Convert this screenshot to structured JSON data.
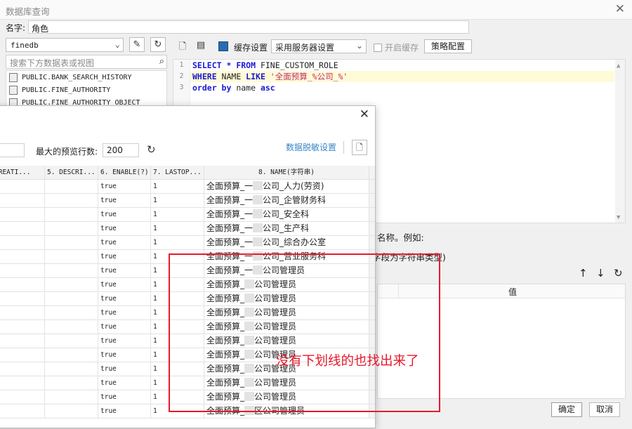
{
  "window": {
    "title": "数据库查询"
  },
  "name_field": {
    "label": "名字:",
    "value": "角色"
  },
  "db_panel": {
    "connection": "finedb",
    "search_placeholder": "搜索下方数据表或视图",
    "tables": [
      "PUBLIC.BANK_SEARCH_HISTORY",
      "PUBLIC.FINE_AUTHORITY",
      "PUBLIC.FINE_AUTHORITY_OBJECT"
    ]
  },
  "toolbar": {
    "cache_settings": "缓存设置",
    "server_setting": "采用服务器设置",
    "enable_cache": "开启缓存",
    "strategy": "策略配置"
  },
  "sql": {
    "line_numbers": [
      "1",
      "2",
      "3"
    ],
    "l1_kw1": "SELECT",
    "l1_star": " * ",
    "l1_kw2": "FROM",
    "l1_rest": " FINE_CUSTOM_ROLE",
    "l2_kw1": "WHERE",
    "l2_mid": " NAME ",
    "l2_kw2": "LIKE",
    "l2_str": " '全面预算_%公司_%'",
    "l3_kw1": "order by",
    "l3_mid": " name ",
    "l3_kw2": "asc"
  },
  "params": {
    "hint1": "名称。例如:",
    "hint2": "字段为字符串类型)",
    "value_header": "值"
  },
  "buttons": {
    "ok": "确定",
    "cancel": "取消"
  },
  "preview": {
    "max_rows_label": "最大的预览行数:",
    "max_rows": "200",
    "mask_settings": "数据脱敏设置",
    "columns": [
      "CREATI...",
      "5. DESCRI...",
      "6. ENABLE(?)",
      "7. LASTOP...",
      "8. NAME(字符串)"
    ],
    "rows": [
      {
        "enable": "true",
        "lastop": "1",
        "name_pre": "全面预算_一",
        "name_post": "公司_人力(劳资)"
      },
      {
        "enable": "true",
        "lastop": "1",
        "name_pre": "全面预算_一",
        "name_post": "公司_企管财务科"
      },
      {
        "enable": "true",
        "lastop": "1",
        "name_pre": "全面预算_一",
        "name_post": "公司_安全科"
      },
      {
        "enable": "true",
        "lastop": "1",
        "name_pre": "全面预算_一",
        "name_post": "公司_生产科"
      },
      {
        "enable": "true",
        "lastop": "1",
        "name_pre": "全面预算_一",
        "name_post": "公司_综合办公室"
      },
      {
        "enable": "true",
        "lastop": "1",
        "name_pre": "全面预算_一",
        "name_post": "公司_营业服务科"
      },
      {
        "enable": "true",
        "lastop": "1",
        "name_pre": "全面预算_一",
        "name_post": "公司管理员"
      },
      {
        "enable": "true",
        "lastop": "1",
        "name_pre": "全面预算_",
        "name_post": "公司管理员"
      },
      {
        "enable": "true",
        "lastop": "1",
        "name_pre": "全面预算_",
        "name_post": "公司管理员"
      },
      {
        "enable": "true",
        "lastop": "1",
        "name_pre": "全面预算_",
        "name_post": "公司管理员"
      },
      {
        "enable": "true",
        "lastop": "1",
        "name_pre": "全面预算_",
        "name_post": "公司管理员"
      },
      {
        "enable": "true",
        "lastop": "1",
        "name_pre": "全面预算_",
        "name_post": "公司管理员"
      },
      {
        "enable": "true",
        "lastop": "1",
        "name_pre": "全面预算_",
        "name_post": "公司管理员"
      },
      {
        "enable": "true",
        "lastop": "1",
        "name_pre": "全面预算_",
        "name_post": "公司管理员"
      },
      {
        "enable": "true",
        "lastop": "1",
        "name_pre": "全面预算_",
        "name_post": "公司管理员"
      },
      {
        "enable": "true",
        "lastop": "1",
        "name_pre": "全面预算_",
        "name_post": "公司管理员"
      },
      {
        "enable": "true",
        "lastop": "1",
        "name_pre": "全面预算_",
        "name_post": "区公司管理员"
      }
    ]
  },
  "annotation": {
    "text": "没有下划线的也找出来了",
    "color": "#e8192c"
  },
  "colors": {
    "keyword": "#1a1ad0",
    "string": "#c0306a",
    "link": "#3a86c8",
    "highlight_line": "#fffbd6"
  },
  "icons": [
    "close-icon",
    "dropdown-caret-icon",
    "edit-icon",
    "refresh-icon",
    "search-icon",
    "preview-icon",
    "save-icon",
    "cache-icon",
    "arrow-up-icon",
    "arrow-down-icon"
  ]
}
